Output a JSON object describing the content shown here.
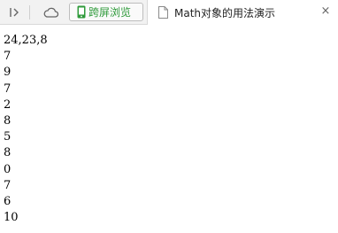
{
  "toolbar": {
    "collapse_icon": "sidebar-toggle-icon",
    "cloud_icon": "cloud-icon",
    "cross_screen_label": "跨屏浏览",
    "cross_screen_icon": "phone-icon",
    "accent_color": "#2e9a3a"
  },
  "tab": {
    "title": "Math对象的用法演示",
    "icon": "document-icon",
    "close_label": "×"
  },
  "output": {
    "lines": [
      "24,23,8",
      "7",
      "9",
      "7",
      "2",
      "8",
      "5",
      "8",
      "0",
      "7",
      "6",
      "10"
    ]
  }
}
